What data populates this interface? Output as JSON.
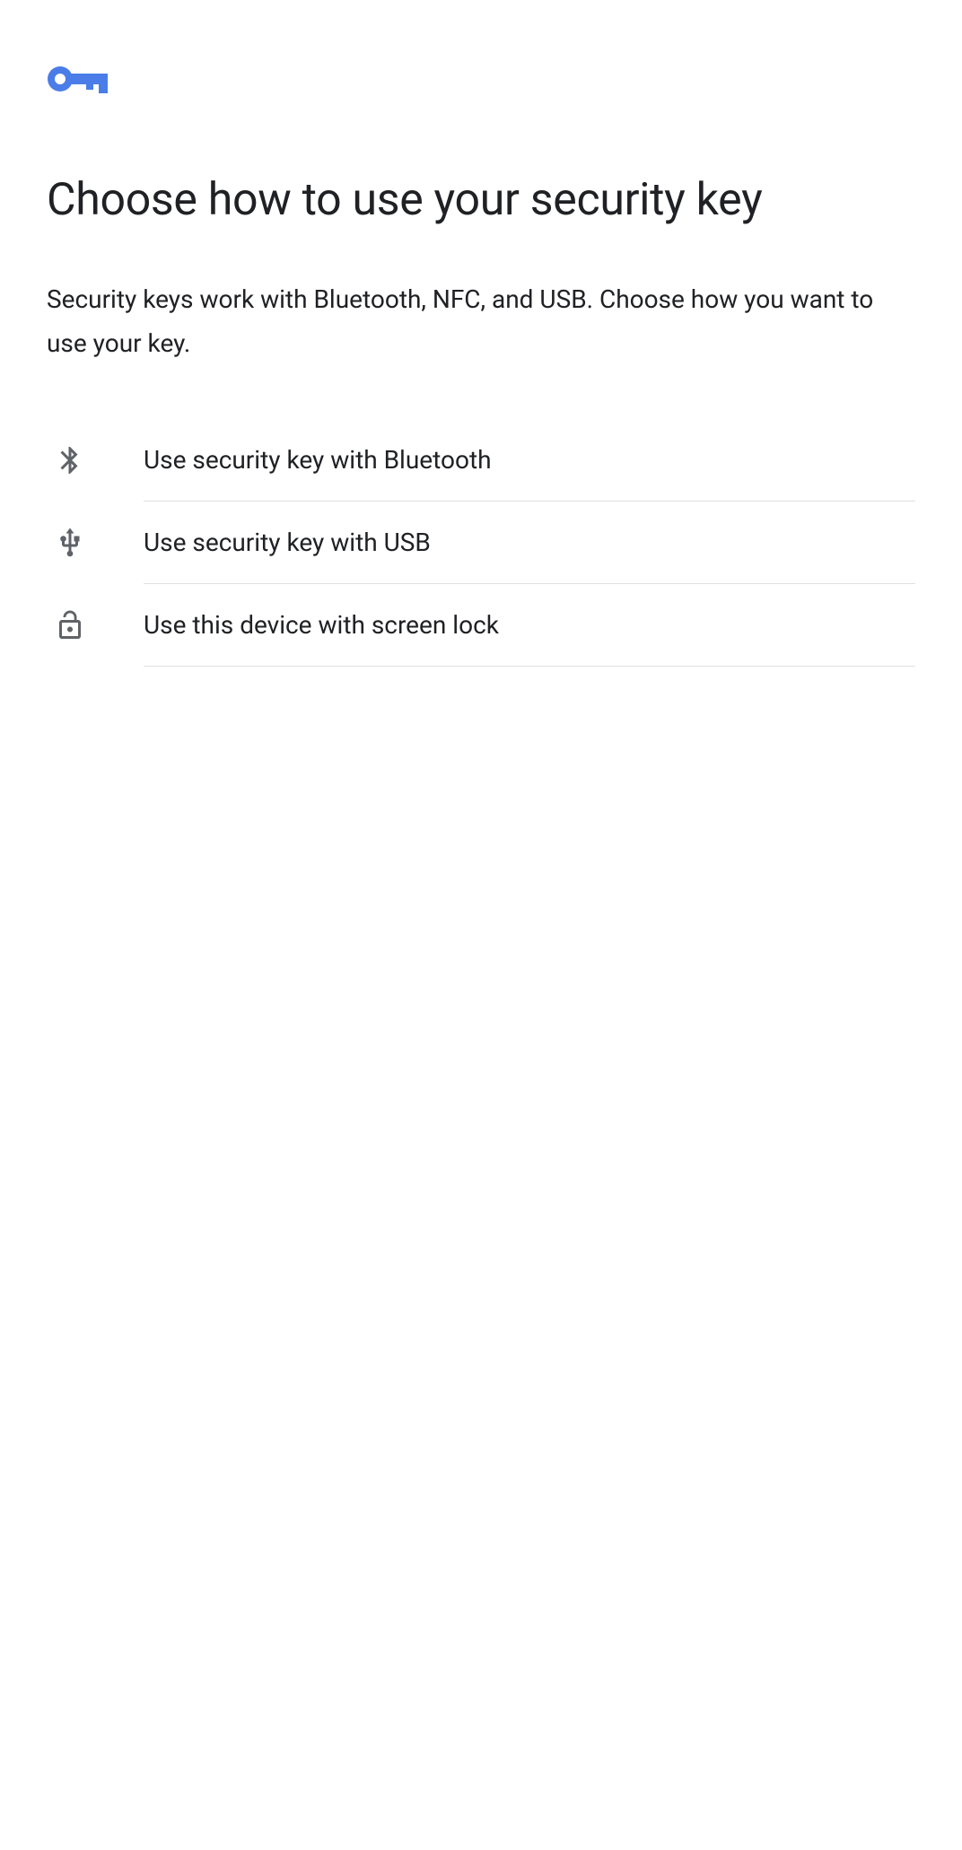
{
  "header": {
    "icon": "key-icon",
    "icon_color": "#4a7de8"
  },
  "title": "Choose how to use your security key",
  "subtitle": "Security keys work with Bluetooth, NFC, and USB. Choose how you want to use your key.",
  "options": [
    {
      "icon": "bluetooth-icon",
      "label": "Use security key with Bluetooth"
    },
    {
      "icon": "usb-icon",
      "label": "Use security key with USB"
    },
    {
      "icon": "lock-open-icon",
      "label": "Use this device with screen lock"
    }
  ]
}
